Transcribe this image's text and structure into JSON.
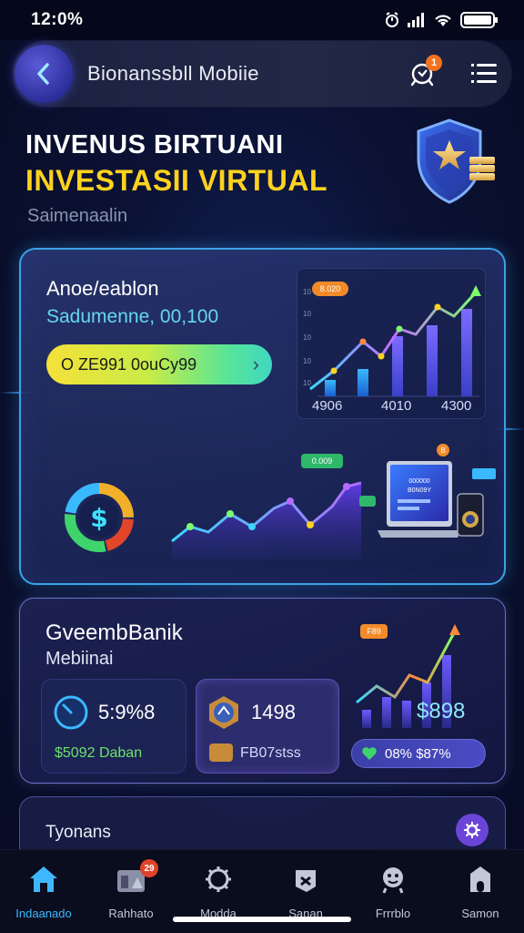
{
  "status": {
    "time": "12:0%"
  },
  "app_bar": {
    "title": "Bionanssbll Mobiie",
    "bell_badge": "1"
  },
  "hero": {
    "title_line1": "INVENUS BIRTUANI",
    "title_line2": "INVESTASII VIRTUAL",
    "subtitle": "Saimenaalin"
  },
  "main_card": {
    "title": "Anoe/eablon",
    "subtitle": "Sadumenne, 00,100",
    "button_label": "O ZE991 0ouCy99",
    "chart_axis_labels": [
      "4906",
      "4010",
      "4300"
    ],
    "chart_tag": "8.020",
    "lower_tag": "0.009",
    "laptop_screen_text": "000000 B0N09Y",
    "donut_symbol": "$"
  },
  "second_card": {
    "title": "GveembBanik",
    "subtitle": "Mebiinai",
    "stat_a_value": "5:9%8",
    "stat_a_footer": "$5092 Daban",
    "stat_b_value": "1498",
    "stat_b_footer": "FB07stss",
    "chart_tag": "F89",
    "chart_value": "$898",
    "change_label": "08% $87%"
  },
  "third_card": {
    "title": "Tyonans"
  },
  "nav": {
    "items": [
      {
        "label": "Indaanado",
        "icon": "home-icon",
        "active": true
      },
      {
        "label": "Rahhato",
        "icon": "portfolio-icon",
        "badge": "29"
      },
      {
        "label": "Modda",
        "icon": "market-icon"
      },
      {
        "label": "Sanan",
        "icon": "trade-icon"
      },
      {
        "label": "Frrrblo",
        "icon": "profile-icon"
      },
      {
        "label": "Samon",
        "icon": "security-icon"
      }
    ]
  },
  "colors": {
    "accent_blue": "#3aa3e6",
    "accent_yellow": "#ffd21f",
    "accent_cyan": "#66d7f0",
    "nav_active": "#3fb7ff"
  }
}
